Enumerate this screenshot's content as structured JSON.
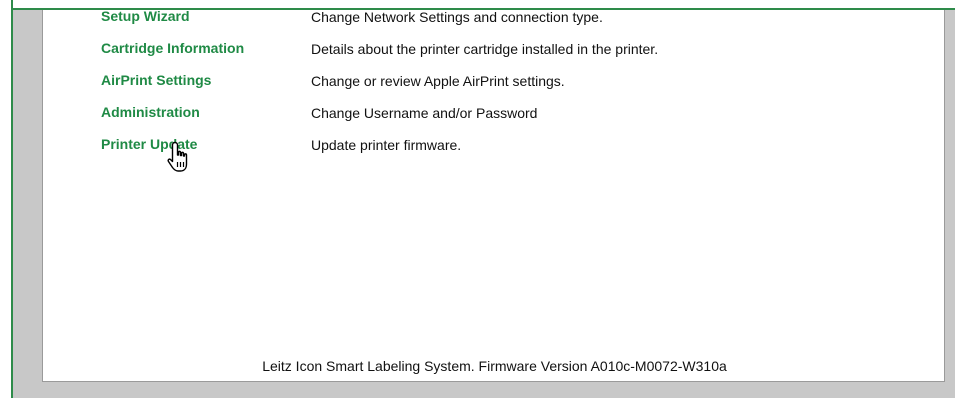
{
  "menu": {
    "items": [
      {
        "label": "Setup Wizard",
        "description": "Change Network Settings and connection type."
      },
      {
        "label": "Cartridge Information",
        "description": "Details about the printer cartridge installed in the printer."
      },
      {
        "label": "AirPrint Settings",
        "description": "Change or review Apple AirPrint settings."
      },
      {
        "label": "Administration",
        "description": "Change Username and/or Password"
      },
      {
        "label": "Printer Update",
        "description": "Update printer firmware."
      }
    ]
  },
  "footer": {
    "text": "Leitz Icon Smart Labeling System. Firmware Version A010c-M0072-W310a"
  },
  "cursor": {
    "icon": "hand-pointer-icon"
  },
  "colors": {
    "link": "#1f8a45",
    "frame": "#2e8b4a",
    "surround": "#c8c8c8"
  }
}
